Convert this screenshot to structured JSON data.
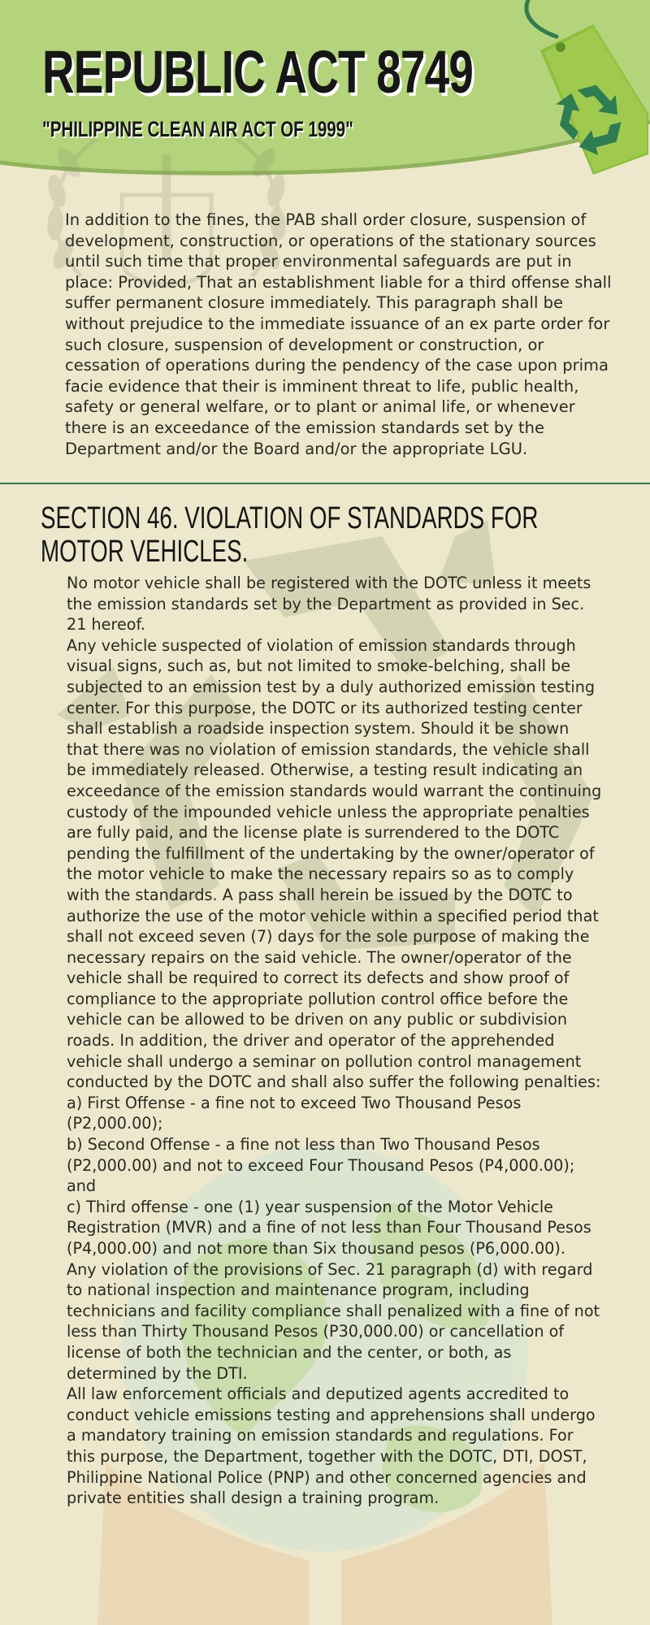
{
  "header": {
    "title": "REPUBLIC ACT 8749",
    "subtitle": "\"PHILIPPINE CLEAN AIR ACT OF 1999\""
  },
  "intro": {
    "text": "In addition to the fines, the PAB shall order closure, suspension of development, construction, or operations of the stationary sources until such time that proper environmental safeguards are put in place: Provided, That an establishment liable for a third offense shall suffer permanent closure immediately. This paragraph shall be without prejudice to the immediate issuance of an ex parte order for such closure, suspension of development or construction, or cessation of operations during the pendency of the case upon prima facie evidence that their is imminent threat to life, public health, safety or general welfare, or to plant or animal life, or whenever there is an exceedance of the emission standards set by the Department and/or the Board and/or the appropriate LGU."
  },
  "section": {
    "heading": "SECTION 46. VIOLATION OF STANDARDS FOR MOTOR VEHICLES.",
    "paragraphs": [
      "No motor vehicle shall be registered with the DOTC unless it meets the emission standards set by the Department as provided in Sec. 21 hereof.",
      "Any vehicle suspected of violation of emission standards through visual signs, such as, but not limited to smoke-belching, shall be subjected to an emission test by a duly authorized emission testing center. For this purpose, the DOTC or its authorized testing center shall establish a roadside inspection system. Should it be shown that there was no violation of emission standards, the vehicle shall be immediately released. Otherwise, a testing result indicating an exceedance of the emission standards would warrant the continuing custody of the impounded vehicle unless the appropriate penalties are fully paid, and the license plate is surrendered to the DOTC pending the fulfillment of the undertaking by the owner/operator of the motor vehicle to make the necessary repairs so as to comply with the standards. A pass shall herein be issued by the DOTC to authorize the use of the motor vehicle within a specified period that shall not exceed seven (7) days for the sole purpose of making the necessary repairs on the said vehicle. The owner/operator of the vehicle shall be required to correct its defects and show proof of compliance to the appropriate pollution control office before the vehicle can be allowed to be driven on any public or subdivision roads. In addition, the driver and operator of the apprehended vehicle shall undergo a seminar on pollution control management conducted by the DOTC and shall also suffer the following penalties:",
      "a) First Offense - a fine not to exceed Two Thousand Pesos (P2,000.00);",
      "b) Second Offense - a fine not less than Two Thousand Pesos (P2,000.00) and not to exceed Four Thousand Pesos (P4,000.00); and",
      "c) Third offense - one (1) year suspension of the Motor Vehicle Registration (MVR) and a fine of not less than Four Thousand Pesos (P4,000.00) and not more than Six thousand pesos (P6,000.00).",
      "Any violation of the provisions of Sec. 21 paragraph (d) with regard to national inspection and maintenance program, including technicians and facility compliance shall penalized with a fine of not less than Thirty Thousand Pesos (P30,000.00) or cancellation of license of both the technician and the center, or both, as determined by the DTI.",
      "All law enforcement officials and deputized agents accredited to conduct vehicle emissions testing and apprehensions shall undergo a mandatory training on emission standards and regulations. For this purpose, the Department, together with the DOTC, DTI, DOST, Philippine National Police (PNP) and other concerned agencies and private entities shall design a training program."
    ]
  },
  "colors": {
    "background": "#ede8cc",
    "header_green": "#b3d47a",
    "tag_green": "#8cbf3e",
    "recycle_green": "#2e7c52",
    "divider": "#2e7c52",
    "text": "#2a2a22"
  },
  "icons": [
    "laurel-emblem-icon",
    "recycle-tag-icon",
    "recycle-watermark-icon",
    "globe-hands-icon"
  ]
}
